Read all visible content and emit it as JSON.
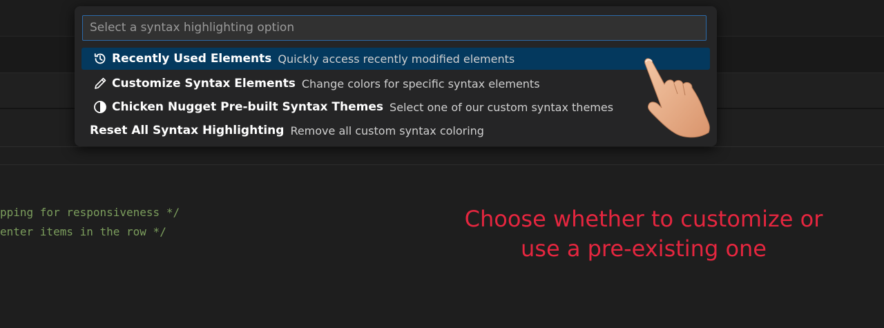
{
  "quick_pick": {
    "placeholder": "Select a syntax highlighting option",
    "items": [
      {
        "icon": "history-icon",
        "label": "Recently Used Elements",
        "description": "Quickly access recently modified elements",
        "selected": true
      },
      {
        "icon": "pencil-icon",
        "label": "Customize Syntax Elements",
        "description": "Change colors for specific syntax elements",
        "selected": false
      },
      {
        "icon": "half-circle-theme-icon",
        "label": "Chicken Nugget Pre-built Syntax Themes",
        "description": "Select one of our custom syntax themes",
        "selected": false
      },
      {
        "icon": null,
        "label": "Reset All Syntax Highlighting",
        "description": "Remove all custom syntax coloring",
        "selected": false
      }
    ]
  },
  "editor": {
    "code_lines": [
      "pping for responsiveness */",
      "enter items in the row */"
    ]
  },
  "caption": {
    "line1": "Choose whether to customize or",
    "line2": "use a pre-existing one"
  },
  "colors": {
    "selection": "#04395e",
    "caption": "#e5263f",
    "comment": "#7c9e5d",
    "input_border": "#2b6aa9"
  }
}
